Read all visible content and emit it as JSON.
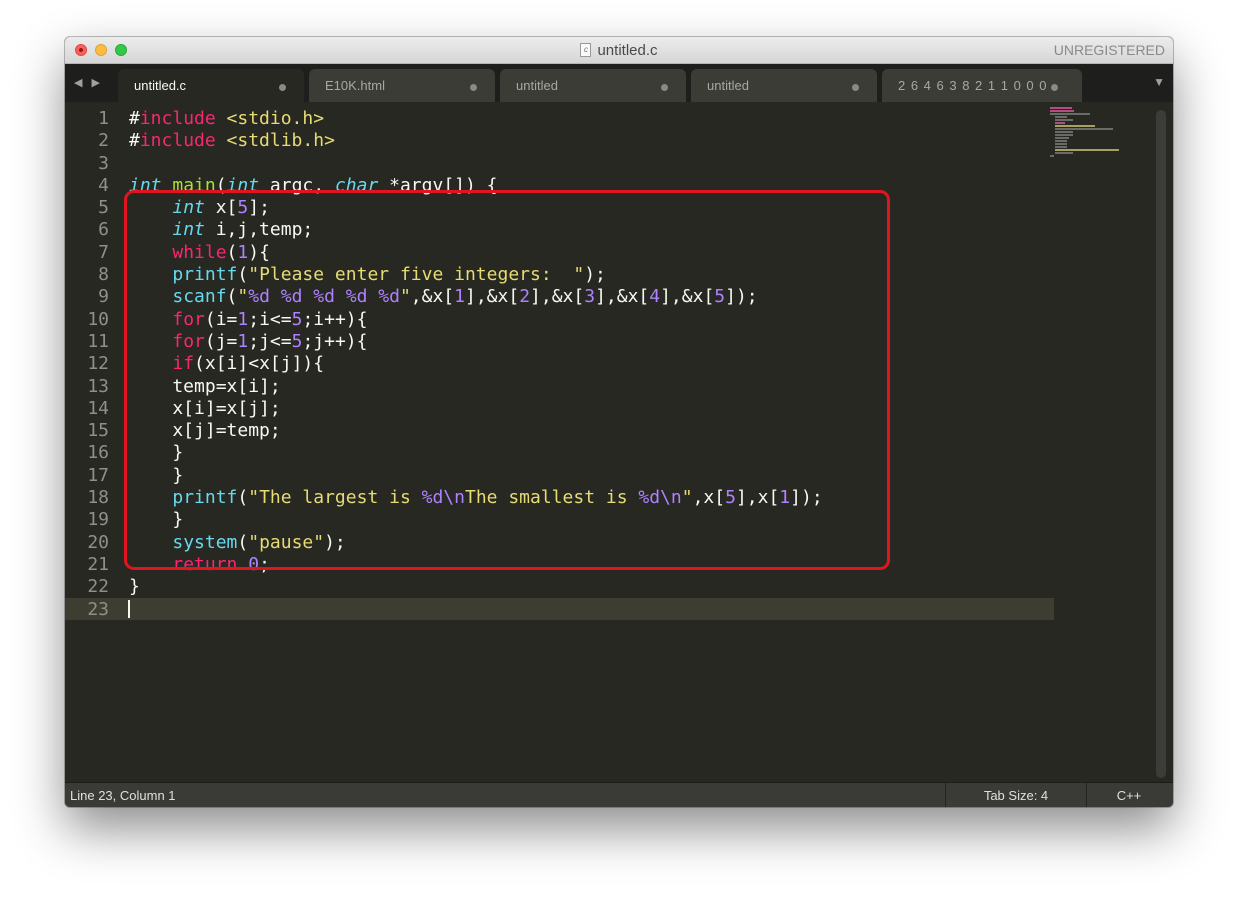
{
  "window": {
    "title": "untitled.c",
    "file_icon": "c",
    "registration": "UNREGISTERED"
  },
  "tabs": [
    {
      "label": "untitled.c",
      "active": true
    },
    {
      "label": "E10K.html",
      "active": false
    },
    {
      "label": "untitled",
      "active": false
    },
    {
      "label": "untitled",
      "active": false
    },
    {
      "label": "2 6 4 6 3 8 2 1 1 0 0 0",
      "active": false
    }
  ],
  "nav": {
    "arrows": "◀ ▶",
    "dropdown": "▼"
  },
  "line_numbers": [
    "1",
    "2",
    "3",
    "4",
    "5",
    "6",
    "7",
    "8",
    "9",
    "10",
    "11",
    "12",
    "13",
    "14",
    "15",
    "16",
    "17",
    "18",
    "19",
    "20",
    "21",
    "22",
    "23"
  ],
  "code": {
    "l1": [
      "#",
      "include",
      " <stdio.h>"
    ],
    "l2": [
      "#",
      "include",
      " <stdlib.h>"
    ],
    "l4": [
      "int",
      " ",
      "main",
      "(",
      "int",
      " argc, ",
      "char",
      " *argv[]) {"
    ],
    "l5": [
      "    ",
      "int",
      " x[",
      "5",
      "];"
    ],
    "l6": [
      "    ",
      "int",
      " i,j,temp;"
    ],
    "l7": [
      "    ",
      "while",
      "(",
      "1",
      "){"
    ],
    "l8": [
      "    ",
      "printf",
      "(",
      "\"Please enter five integers:  \"",
      ");"
    ],
    "l9": [
      "    ",
      "scanf",
      "(",
      "\"",
      "%d %d %d %d %d",
      "\"",
      ",&x[",
      "1",
      "],&x[",
      "2",
      "],&x[",
      "3",
      "],&x[",
      "4",
      "],&x[",
      "5",
      "]);"
    ],
    "l10": [
      "    ",
      "for",
      "(i=",
      "1",
      ";i<=",
      "5",
      ";i++){"
    ],
    "l11": [
      "    ",
      "for",
      "(j=",
      "1",
      ";j<=",
      "5",
      ";j++){"
    ],
    "l12": [
      "    ",
      "if",
      "(x[i]<x[j]){"
    ],
    "l13": "    temp=x[i];",
    "l14": "    x[i]=x[j];",
    "l15": "    x[j]=temp;",
    "l16": "    }",
    "l17": "    }",
    "l18": [
      "    ",
      "printf",
      "(",
      "\"The largest is ",
      "%d\\n",
      "The smallest is ",
      "%d\\n",
      "\"",
      ",x[",
      "5",
      "],x[",
      "1",
      "]);"
    ],
    "l19": "    }",
    "l20": [
      "    ",
      "system",
      "(",
      "\"pause\"",
      ");"
    ],
    "l21": [
      "    ",
      "return",
      " ",
      "0",
      ";"
    ],
    "l22": "}"
  },
  "status": {
    "position": "Line 23, Column 1",
    "tab_size": "Tab Size: 4",
    "syntax": "C++"
  },
  "colors": {
    "background": "#272822",
    "keyword": "#f92672",
    "type": "#66d9ef",
    "number": "#ae81ff",
    "string": "#e6db74",
    "function_def": "#a6e22e",
    "annotation_box": "#e0151f"
  }
}
